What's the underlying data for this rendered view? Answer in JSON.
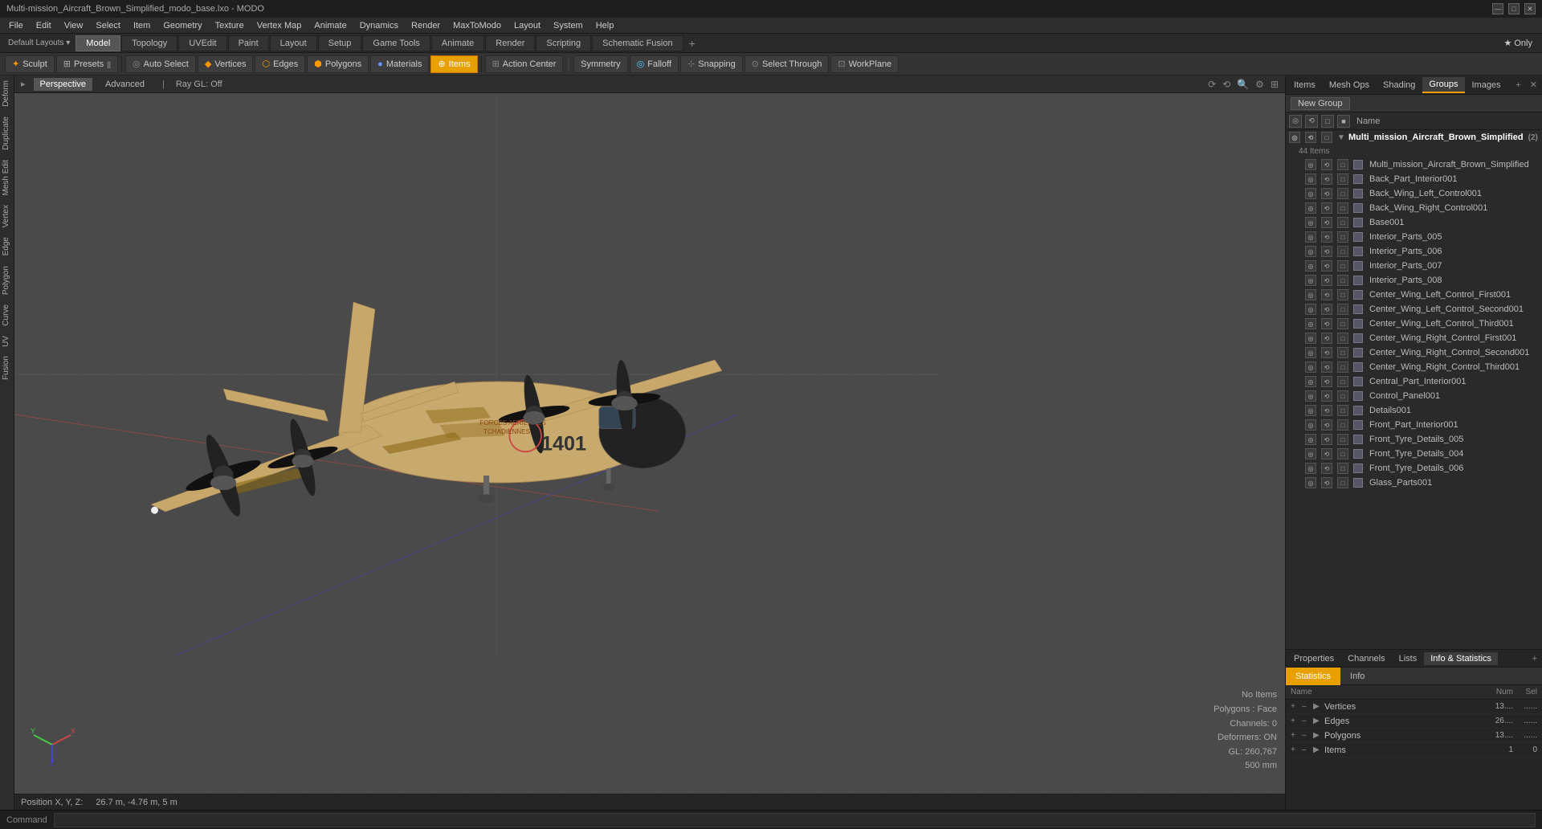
{
  "window": {
    "title": "Multi-mission_Aircraft_Brown_Simplified_modo_base.lxo - MODO"
  },
  "titlebar": {
    "controls": [
      "—",
      "□",
      "✕"
    ]
  },
  "menubar": {
    "items": [
      "File",
      "Edit",
      "View",
      "Select",
      "Item",
      "Geometry",
      "Texture",
      "Vertex Map",
      "Animate",
      "Dynamics",
      "Render",
      "MaxToModo",
      "Layout",
      "System",
      "Help"
    ]
  },
  "maintabs": {
    "items": [
      "Model",
      "Topology",
      "UVEdit",
      "Paint",
      "Layout",
      "Setup",
      "Game Tools",
      "Animate",
      "Render",
      "Scripting",
      "Schematic Fusion"
    ],
    "active": "Model",
    "add_label": "+",
    "star_label": "★ Only"
  },
  "modetoolbar": {
    "sculpt": "Sculpt",
    "presets": "Presets",
    "presets_icon": "||",
    "auto_select": "Auto Select",
    "vertices": "Vertices",
    "edges": "Edges",
    "polygons": "Polygons",
    "materials": "Materials",
    "items": "Items",
    "action_center": "Action Center",
    "symmetry": "Symmetry",
    "falloff": "Falloff",
    "snapping": "Snapping",
    "select_through": "Select Through",
    "workplane": "WorkPlane"
  },
  "leftsidebar": {
    "items": [
      "Deform",
      "Duplicate",
      "Mesh Edit",
      "Vertex",
      "Edge",
      "Polygon",
      "Curve",
      "UV",
      "Fusion"
    ]
  },
  "viewport": {
    "tabs": [
      "Perspective",
      "Advanced"
    ],
    "raygl": "Ray GL: Off",
    "icons": [
      "⟳",
      "⟲",
      "🔍",
      "⚙",
      "⊞"
    ]
  },
  "viewport3d": {
    "no_items": "No Items",
    "polygons_face": "Polygons : Face",
    "channels": "Channels: 0",
    "deformers": "Deformers: ON",
    "gl_info": "GL: 260,767",
    "size": "500 mm"
  },
  "rightpanel": {
    "tabs": [
      "Items",
      "Mesh Ops",
      "Shading",
      "Groups",
      "Images"
    ],
    "active": "Groups",
    "add_label": "+",
    "close_label": "✕"
  },
  "groups": {
    "new_group_btn": "New Group",
    "name_col": "Name",
    "root": {
      "name": "Multi_mission_Aircraft_Brown_Simplified",
      "count": 2,
      "item_count": "44 Items",
      "children": [
        "Multi_mission_Aircraft_Brown_Simplified",
        "Back_Part_Interior001",
        "Back_Wing_Left_Control001",
        "Back_Wing_Right_Control001",
        "Base001",
        "Interior_Parts_005",
        "Interior_Parts_006",
        "Interior_Parts_007",
        "Interior_Parts_008",
        "Center_Wing_Left_Control_First001",
        "Center_Wing_Left_Control_Second001",
        "Center_Wing_Left_Control_Third001",
        "Center_Wing_Right_Control_First001",
        "Center_Wing_Right_Control_Second001",
        "Center_Wing_Right_Control_Third001",
        "Central_Part_Interior001",
        "Control_Panel001",
        "Details001",
        "Front_Part_Interior001",
        "Front_Tyre_Details_005",
        "Front_Tyre_Details_004",
        "Front_Tyre_Details_006",
        "Glass_Parts001"
      ]
    }
  },
  "bottompanel": {
    "tabs": [
      "Properties",
      "Channels",
      "Lists",
      "Info & Statistics"
    ],
    "active": "Info & Statistics",
    "add_label": "+",
    "stat_tabs": [
      "Statistics",
      "Info"
    ],
    "active_stat": "Statistics",
    "header": {
      "name": "Name",
      "num": "Num",
      "sel": "Sel"
    },
    "rows": [
      {
        "name": "Vertices",
        "num": "13....",
        "sel": "......"
      },
      {
        "name": "Edges",
        "num": "26....",
        "sel": "......"
      },
      {
        "name": "Polygons",
        "num": "13....",
        "sel": "......"
      },
      {
        "name": "Items",
        "num": "1",
        "sel": "0"
      }
    ]
  },
  "positionbar": {
    "label": "Position X, Y, Z:",
    "value": "26.7 m, -4.76 m, 5 m"
  },
  "commandbar": {
    "label": "Command",
    "placeholder": ""
  }
}
